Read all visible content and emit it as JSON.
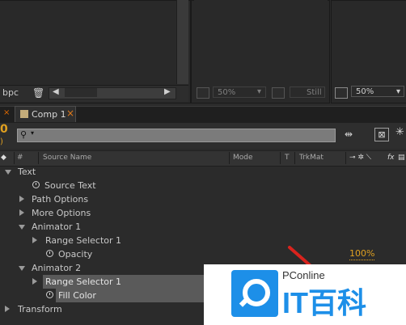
{
  "top_panels": {
    "left_label": "bpc",
    "viewer2": {
      "zoom": "50%",
      "quality": "Still"
    },
    "viewer3": {
      "zoom": "50%"
    }
  },
  "timeline": {
    "left_number": "0",
    "tab_label": "Comp 1",
    "tab_close": "×",
    "search_placeholder": "",
    "columns": {
      "num": "#",
      "source_name": "Source Name",
      "mode": "Mode",
      "t": "T",
      "trkmat": "TrkMat",
      "fx": "fx"
    },
    "rows": [
      {
        "label": "Text",
        "level": 0,
        "expand": "down"
      },
      {
        "label": "Source Text",
        "level": 2,
        "stopwatch": true
      },
      {
        "label": "Path Options",
        "level": 1,
        "expand": "right"
      },
      {
        "label": "More Options",
        "level": 1,
        "expand": "right"
      },
      {
        "label": "Animator 1",
        "level": 1,
        "expand": "down"
      },
      {
        "label": "Range Selector 1",
        "level": 2,
        "expand": "right"
      },
      {
        "label": "Opacity",
        "level": 3,
        "stopwatch": true,
        "value": "100%"
      },
      {
        "label": "Animator 2",
        "level": 1,
        "expand": "down"
      },
      {
        "label": "Range Selector 1",
        "level": 2,
        "expand": "right",
        "selected": true
      },
      {
        "label": "Fill Color",
        "level": 3,
        "stopwatch": true,
        "selected": true
      },
      {
        "label": "Transform",
        "level": 0,
        "expand": "right"
      }
    ]
  },
  "watermark": {
    "brand": "PConline",
    "logo_text": "IT百科"
  },
  "colors": {
    "accent_value": "#e0a020",
    "arrow": "#d9231d"
  }
}
